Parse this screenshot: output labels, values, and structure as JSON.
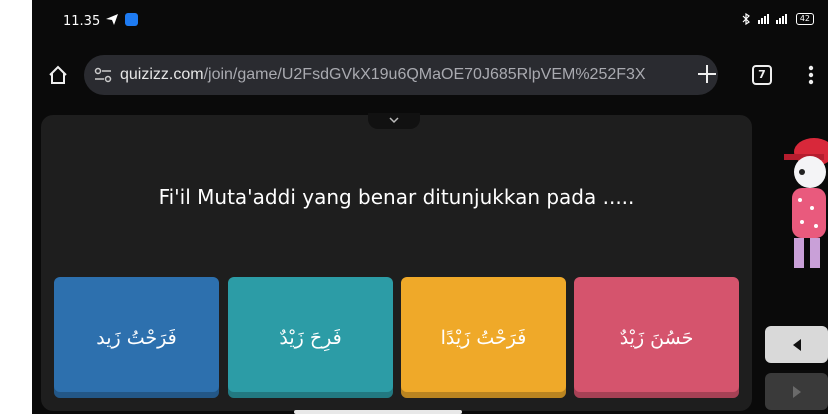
{
  "status": {
    "time": "11.35",
    "battery": "42"
  },
  "browser": {
    "url_host": "quizizz.com",
    "url_path": "/join/game/U2FsdGVkX19u6QMaOE70J685RlpVEM%252F3X",
    "tab_count": "7"
  },
  "quiz": {
    "question": "Fi'il Muta'addi yang benar ditunjukkan pada .....",
    "options": [
      "فَرَحْتُ زَيد",
      "فَرِحَ زَيْدٌ",
      "فَرَحْتُ زَيْدًا",
      "حَسُنَ زَيْدٌ"
    ],
    "option_colors": [
      "#2d70ae",
      "#2c9ca6",
      "#efa929",
      "#d5546d"
    ]
  },
  "icons": [
    "telegram-send-icon",
    "app-notification-icon",
    "bluetooth-icon",
    "signal-icon",
    "battery-icon",
    "home-icon",
    "site-settings-icon",
    "new-tab-plus-icon",
    "tabs-icon",
    "overflow-menu-icon",
    "chevron-down-icon",
    "left-arrow-icon",
    "right-arrow-icon"
  ]
}
